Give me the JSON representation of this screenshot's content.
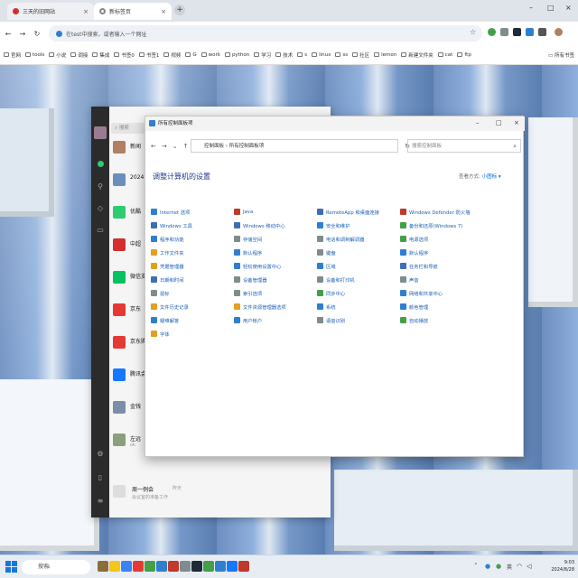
{
  "browser": {
    "tabs": [
      {
        "label": "三天的旧网站",
        "icon": "red-circle-icon",
        "active": false
      },
      {
        "label": "新标签页",
        "icon": "chrome-icon",
        "active": true
      }
    ],
    "new_tab_symbol": "+",
    "window_controls": [
      "–",
      "□",
      "×"
    ],
    "address_placeholder": "在test中搜索，或者输入一个网址",
    "bookmarks": [
      "官网",
      "tools",
      "小说",
      "调接",
      "集成",
      "书签0",
      "书签1",
      "视频",
      "G",
      "work",
      "python",
      "学习",
      "技术",
      "s",
      "linux",
      "ss",
      "社区",
      "lemon",
      "新建文件夹",
      "cat",
      "ftp"
    ],
    "all_bookmarks": "所有书签"
  },
  "chat_app": {
    "search_placeholder": "搜索",
    "conversations": [
      {
        "name": "新闻",
        "preview": "",
        "color": "#b08060"
      },
      {
        "name": "2024",
        "preview": "",
        "color": "#6a8fbf"
      },
      {
        "name": "优酷",
        "preview": "",
        "color": "#2ecc71"
      },
      {
        "name": "中超",
        "preview": "",
        "color": "#d32f2f"
      },
      {
        "name": "微信支付",
        "preview": "",
        "color": "#07c160"
      },
      {
        "name": "京东",
        "preview": "",
        "color": "#e53935"
      },
      {
        "name": "京东购物",
        "preview": "",
        "color": "#e53935"
      },
      {
        "name": "腾讯会议",
        "preview": "",
        "color": "#1677ff"
      },
      {
        "name": "金钱",
        "preview": "",
        "color": "#7b8fa8"
      },
      {
        "name": "左远",
        "preview": "ok",
        "color": "#8aa07a"
      }
    ],
    "footer_item": {
      "name": "周一例会",
      "meta": "昨天",
      "preview": "会议室的准备工作"
    }
  },
  "control_panel": {
    "window_title": "所有控制面板项",
    "window_controls": [
      "–",
      "□",
      "×"
    ],
    "breadcrumb": "控制面板 › 所有控制面板项",
    "search_placeholder": "搜索控制面板",
    "heading": "调整计算机的设置",
    "view_label": "查看方式:",
    "view_value": "小图标 ▾",
    "items": [
      {
        "label": "Internet 选项",
        "color": "#2f7fd0"
      },
      {
        "label": "Java",
        "color": "#c0392b"
      },
      {
        "label": "RemoteApp 和桌面连接",
        "color": "#3d6fb6"
      },
      {
        "label": "Windows Defender 防火墙",
        "color": "#c0392b"
      },
      {
        "label": "Windows 工具",
        "color": "#3d6fb6"
      },
      {
        "label": "Windows 移动中心",
        "color": "#3d6fb6"
      },
      {
        "label": "安全和维护",
        "color": "#2f7fd0"
      },
      {
        "label": "备份和还原(Windows 7)",
        "color": "#43a047"
      },
      {
        "label": "程序和功能",
        "color": "#2f7fd0"
      },
      {
        "label": "存储空间",
        "color": "#7f8c8d"
      },
      {
        "label": "电话和调制解调器",
        "color": "#7f8c8d"
      },
      {
        "label": "电源选项",
        "color": "#43a047"
      },
      {
        "label": "工作文件夹",
        "color": "#e0a020"
      },
      {
        "label": "默认程序",
        "color": "#2f7fd0"
      },
      {
        "label": "键盘",
        "color": "#7f8c8d"
      },
      {
        "label": "默认程序",
        "color": "#2f7fd0"
      },
      {
        "label": "凭据管理器",
        "color": "#e0a020"
      },
      {
        "label": "轻松使用设置中心",
        "color": "#2f7fd0"
      },
      {
        "label": "区域",
        "color": "#2f7fd0"
      },
      {
        "label": "任务栏和导航",
        "color": "#3d6fb6"
      },
      {
        "label": "日期和时间",
        "color": "#3d6fb6"
      },
      {
        "label": "设备管理器",
        "color": "#7f8c8d"
      },
      {
        "label": "设备和打印机",
        "color": "#7f8c8d"
      },
      {
        "label": "声音",
        "color": "#7f8c8d"
      },
      {
        "label": "鼠标",
        "color": "#7f8c8d"
      },
      {
        "label": "索引选项",
        "color": "#7f8c8d"
      },
      {
        "label": "同步中心",
        "color": "#43a047"
      },
      {
        "label": "网络和共享中心",
        "color": "#2f7fd0"
      },
      {
        "label": "文件历史记录",
        "color": "#e0a020"
      },
      {
        "label": "文件资源管理器选项",
        "color": "#e0a020"
      },
      {
        "label": "系统",
        "color": "#2f7fd0"
      },
      {
        "label": "颜色管理",
        "color": "#2f7fd0"
      },
      {
        "label": "疑难解答",
        "color": "#2f7fd0"
      },
      {
        "label": "用户帐户",
        "color": "#2f7fd0"
      },
      {
        "label": "语音识别",
        "color": "#7f8c8d"
      },
      {
        "label": "自动播放",
        "color": "#43a047"
      },
      {
        "label": "字体",
        "color": "#e0a020"
      }
    ]
  },
  "taskbar": {
    "search_placeholder": "搜索",
    "apps": [
      "#8a6d3b",
      "#f5c518",
      "#3b82f6",
      "#e53935",
      "#43a047",
      "#2f7fd0",
      "#c0392b",
      "#7f8c8d",
      "#1f2937",
      "#43a047",
      "#2f7fd0",
      "#1677ff",
      "#c0392b"
    ],
    "tray_time": "9:03",
    "tray_date": "2024/8/28",
    "ime": "英"
  },
  "colors": {
    "accent": "#1a5fb4",
    "title_blue": "#1e3a8a"
  }
}
